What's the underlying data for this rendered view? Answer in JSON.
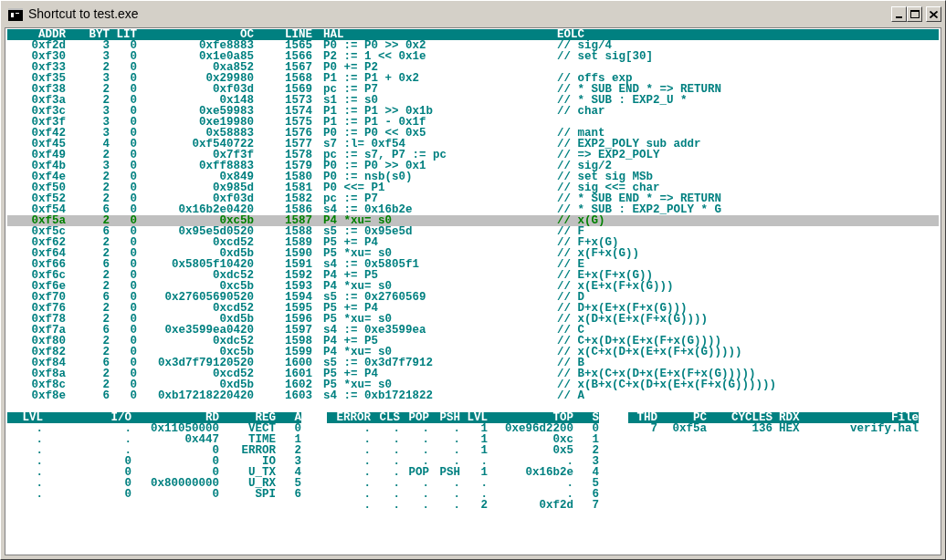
{
  "window": {
    "title": "Shortcut to test.exe"
  },
  "listing": {
    "columns": [
      "ADDR",
      "BYT",
      "LIT",
      "OC",
      "LINE",
      "HAL",
      "EOLC"
    ],
    "rows": [
      {
        "addr": "0xf2d",
        "byt": "3",
        "lit": "0",
        "oc": "0xfe8883",
        "line": "1565",
        "hal": "P0 := P0 >> 0x2",
        "eolc": "// sig/4",
        "selected": false
      },
      {
        "addr": "0xf30",
        "byt": "3",
        "lit": "0",
        "oc": "0x1e0a85",
        "line": "1566",
        "hal": "P2 := 1 << 0x1e",
        "eolc": "// set sig[30]",
        "selected": false
      },
      {
        "addr": "0xf33",
        "byt": "2",
        "lit": "0",
        "oc": "0xa852",
        "line": "1567",
        "hal": "P0 += P2",
        "selected": false
      },
      {
        "addr": "0xf35",
        "byt": "3",
        "lit": "0",
        "oc": "0x29980",
        "line": "1568",
        "hal": "P1 := P1 + 0x2",
        "eolc": "// offs exp",
        "selected": false
      },
      {
        "addr": "0xf38",
        "byt": "2",
        "lit": "0",
        "oc": "0xf03d",
        "line": "1569",
        "hal": "pc := P7",
        "eolc": "// * SUB END * => RETURN",
        "selected": false
      },
      {
        "addr": "0xf3a",
        "byt": "2",
        "lit": "0",
        "oc": "0x148",
        "line": "1573",
        "hal": "s1 := s0",
        "eolc": "// * SUB : EXP2_U *",
        "selected": false
      },
      {
        "addr": "0xf3c",
        "byt": "3",
        "lit": "0",
        "oc": "0xe59983",
        "line": "1574",
        "hal": "P1 := P1 >> 0x1b",
        "eolc": "// char",
        "selected": false
      },
      {
        "addr": "0xf3f",
        "byt": "3",
        "lit": "0",
        "oc": "0xe19980",
        "line": "1575",
        "hal": "P1 := P1 - 0x1f",
        "selected": false
      },
      {
        "addr": "0xf42",
        "byt": "3",
        "lit": "0",
        "oc": "0x58883",
        "line": "1576",
        "hal": "P0 := P0 << 0x5",
        "eolc": "// mant",
        "selected": false
      },
      {
        "addr": "0xf45",
        "byt": "4",
        "lit": "0",
        "oc": "0xf540722",
        "line": "1577",
        "hal": "s7 :l= 0xf54",
        "eolc": "// EXP2_POLY sub addr",
        "selected": false
      },
      {
        "addr": "0xf49",
        "byt": "2",
        "lit": "0",
        "oc": "0x7f3f",
        "line": "1578",
        "hal": "pc := s7, P7 := pc",
        "eolc": "// => EXP2_POLY",
        "selected": false
      },
      {
        "addr": "0xf4b",
        "byt": "3",
        "lit": "0",
        "oc": "0xff8883",
        "line": "1579",
        "hal": "P0 := P0 >> 0x1",
        "eolc": "// sig/2",
        "selected": false
      },
      {
        "addr": "0xf4e",
        "byt": "2",
        "lit": "0",
        "oc": "0x849",
        "line": "1580",
        "hal": "P0 := nsb(s0)",
        "eolc": "// set sig MSb",
        "selected": false
      },
      {
        "addr": "0xf50",
        "byt": "2",
        "lit": "0",
        "oc": "0x985d",
        "line": "1581",
        "hal": "P0 <<= P1",
        "eolc": "// sig <<= char",
        "selected": false
      },
      {
        "addr": "0xf52",
        "byt": "2",
        "lit": "0",
        "oc": "0xf03d",
        "line": "1582",
        "hal": "pc := P7",
        "eolc": "// * SUB END * => RETURN",
        "selected": false
      },
      {
        "addr": "0xf54",
        "byt": "6",
        "lit": "0",
        "oc": "0x16b2e0420",
        "line": "1586",
        "hal": "s4 := 0x16b2e",
        "eolc": "// * SUB : EXP2_POLY * G",
        "selected": false
      },
      {
        "addr": "0xf5a",
        "byt": "2",
        "lit": "0",
        "oc": "0xc5b",
        "line": "1587",
        "hal": "P4 *xu= s0",
        "eolc": "// x(G)",
        "selected": true
      },
      {
        "addr": "0xf5c",
        "byt": "6",
        "lit": "0",
        "oc": "0x95e5d0520",
        "line": "1588",
        "hal": "s5 := 0x95e5d",
        "eolc": "// F",
        "selected": false
      },
      {
        "addr": "0xf62",
        "byt": "2",
        "lit": "0",
        "oc": "0xcd52",
        "line": "1589",
        "hal": "P5 += P4",
        "eolc": "// F+x(G)",
        "selected": false
      },
      {
        "addr": "0xf64",
        "byt": "2",
        "lit": "0",
        "oc": "0xd5b",
        "line": "1590",
        "hal": "P5 *xu= s0",
        "eolc": "// x(F+x(G))",
        "selected": false
      },
      {
        "addr": "0xf66",
        "byt": "6",
        "lit": "0",
        "oc": "0x5805f10420",
        "line": "1591",
        "hal": "s4 := 0x5805f1",
        "eolc": "// E",
        "selected": false
      },
      {
        "addr": "0xf6c",
        "byt": "2",
        "lit": "0",
        "oc": "0xdc52",
        "line": "1592",
        "hal": "P4 += P5",
        "eolc": "// E+x(F+x(G))",
        "selected": false
      },
      {
        "addr": "0xf6e",
        "byt": "2",
        "lit": "0",
        "oc": "0xc5b",
        "line": "1593",
        "hal": "P4 *xu= s0",
        "eolc": "// x(E+x(F+x(G)))",
        "selected": false
      },
      {
        "addr": "0xf70",
        "byt": "6",
        "lit": "0",
        "oc": "0x27605690520",
        "line": "1594",
        "hal": "s5 := 0x2760569",
        "eolc": "// D",
        "selected": false
      },
      {
        "addr": "0xf76",
        "byt": "2",
        "lit": "0",
        "oc": "0xcd52",
        "line": "1595",
        "hal": "P5 += P4",
        "eolc": "// D+x(E+x(F+x(G)))",
        "selected": false
      },
      {
        "addr": "0xf78",
        "byt": "2",
        "lit": "0",
        "oc": "0xd5b",
        "line": "1596",
        "hal": "P5 *xu= s0",
        "eolc": "// x(D+x(E+x(F+x(G))))",
        "selected": false
      },
      {
        "addr": "0xf7a",
        "byt": "6",
        "lit": "0",
        "oc": "0xe3599ea0420",
        "line": "1597",
        "hal": "s4 := 0xe3599ea",
        "eolc": "// C",
        "selected": false
      },
      {
        "addr": "0xf80",
        "byt": "2",
        "lit": "0",
        "oc": "0xdc52",
        "line": "1598",
        "hal": "P4 += P5",
        "eolc": "// C+x(D+x(E+x(F+x(G))))",
        "selected": false
      },
      {
        "addr": "0xf82",
        "byt": "2",
        "lit": "0",
        "oc": "0xc5b",
        "line": "1599",
        "hal": "P4 *xu= s0",
        "eolc": "// x(C+x(D+x(E+x(F+x(G)))))",
        "selected": false
      },
      {
        "addr": "0xf84",
        "byt": "6",
        "lit": "0",
        "oc": "0x3d7f79120520",
        "line": "1600",
        "hal": "s5 := 0x3d7f7912",
        "eolc": "// B",
        "selected": false
      },
      {
        "addr": "0xf8a",
        "byt": "2",
        "lit": "0",
        "oc": "0xcd52",
        "line": "1601",
        "hal": "P5 += P4",
        "eolc": "// B+x(C+x(D+x(E+x(F+x(G)))))",
        "selected": false
      },
      {
        "addr": "0xf8c",
        "byt": "2",
        "lit": "0",
        "oc": "0xd5b",
        "line": "1602",
        "hal": "P5 *xu= s0",
        "eolc": "// x(B+x(C+x(D+x(E+x(F+x(G))))))",
        "selected": false
      },
      {
        "addr": "0xf8e",
        "byt": "6",
        "lit": "0",
        "oc": "0xb17218220420",
        "line": "1603",
        "hal": "s4 := 0xb1721822",
        "eolc": "// A",
        "selected": false
      }
    ]
  },
  "registers": {
    "columns": [
      "LVL",
      "I/O",
      "RD",
      "REG",
      "A"
    ],
    "rows": [
      [
        ".",
        ".",
        "0x11050000",
        "VECT",
        "0"
      ],
      [
        ".",
        ".",
        "0x447",
        "TIME",
        "1"
      ],
      [
        ".",
        ".",
        "0",
        "ERROR",
        "2"
      ],
      [
        ".",
        "0",
        "0",
        "IO",
        "3"
      ],
      [
        ".",
        "0",
        "0",
        "U_TX",
        "4"
      ],
      [
        ".",
        "0",
        "0x80000000",
        "U_RX",
        "5"
      ],
      [
        ".",
        "0",
        "0",
        "SPI",
        "6"
      ]
    ]
  },
  "stack": {
    "columns": [
      "ERROR",
      "CLS",
      "POP",
      "PSH",
      "LVL",
      "TOP",
      "S"
    ],
    "rows": [
      [
        ".",
        ".",
        ".",
        ".",
        "1",
        "0xe96d2200",
        "0"
      ],
      [
        ".",
        ".",
        ".",
        ".",
        "1",
        "0xc",
        "1"
      ],
      [
        ".",
        ".",
        ".",
        ".",
        "1",
        "0x5",
        "2"
      ],
      [
        ".",
        ".",
        ".",
        ".",
        ".",
        ".",
        "3"
      ],
      [
        ".",
        ".",
        "POP",
        "PSH",
        "1",
        "0x16b2e",
        "4"
      ],
      [
        ".",
        ".",
        ".",
        ".",
        ".",
        ".",
        "5"
      ],
      [
        ".",
        ".",
        ".",
        ".",
        ".",
        ".",
        "6"
      ],
      [
        ".",
        ".",
        ".",
        ".",
        "2",
        "0xf2d",
        "7"
      ]
    ]
  },
  "threads": {
    "columns": [
      "THD",
      "PC",
      "CYCLES",
      "RDX",
      "File"
    ],
    "rows": [
      [
        "7",
        "0xf5a",
        "136",
        "HEX",
        "verify.hal"
      ]
    ]
  }
}
